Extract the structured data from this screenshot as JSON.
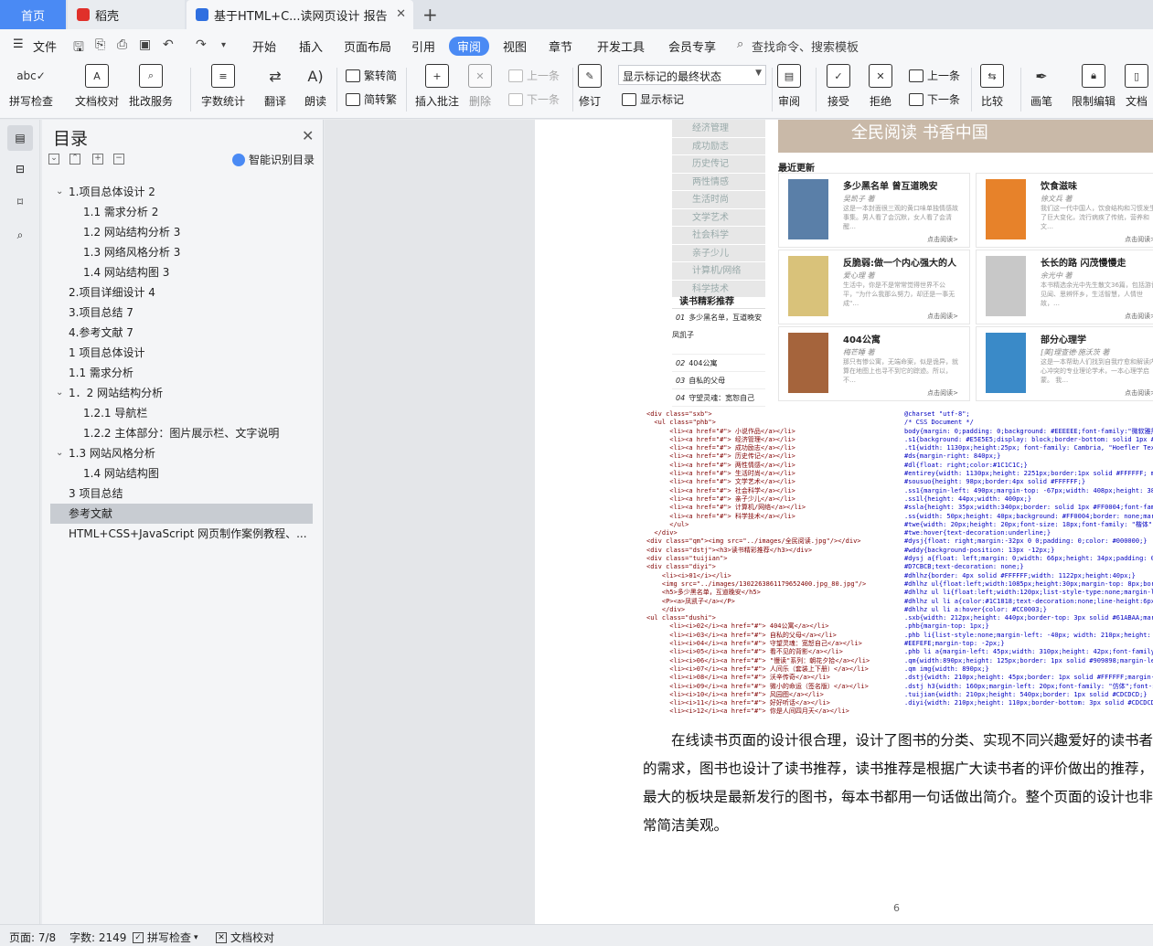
{
  "tabs": {
    "home": "首页",
    "daoke": "稻壳",
    "doc": "基于HTML+C...读网页设计 报告"
  },
  "menu": {
    "file": "文件",
    "items": [
      "开始",
      "插入",
      "页面布局",
      "引用",
      "审阅",
      "视图",
      "章节",
      "开发工具",
      "会员专享"
    ],
    "search": "查找命令、搜索模板"
  },
  "toolbar": {
    "spellcheck": "拼写检查",
    "doc_check": "文档校对",
    "batch": "批改服务",
    "word_count": "字数统计",
    "translate": "翻译",
    "read_aloud": "朗读",
    "to_trad": "繁转简",
    "to_simp": "简转繁",
    "insert_comment": "插入批注",
    "delete": "删除",
    "prev_comment": "上一条",
    "next_comment": "下一条",
    "revise": "修订",
    "markup_mode": "显示标记的最终状态",
    "show_markup": "显示标记",
    "review": "审阅",
    "accept": "接受",
    "reject": "拒绝",
    "prev": "上一条",
    "next": "下一条",
    "compare": "比较",
    "pen": "画笔",
    "restrict": "限制编辑",
    "doc_right": "文档"
  },
  "toc": {
    "title": "目录",
    "smart": "智能识别目录",
    "items": [
      {
        "label": "1.项目总体设计  2",
        "caret": "v"
      },
      {
        "label": "1.1 需求分析  2",
        "caret": ""
      },
      {
        "label": "1.2 网站结构分析  3",
        "caret": ""
      },
      {
        "label": "1.3 网络风格分析  3",
        "caret": ""
      },
      {
        "label": "1.4 网站结构图  3",
        "caret": ""
      },
      {
        "label": "2.项目详细设计  4",
        "caret": ""
      },
      {
        "label": "3.项目总结  7",
        "caret": ""
      },
      {
        "label": "4.参考文献  7",
        "caret": ""
      },
      {
        "label": "1 项目总体设计",
        "caret": ""
      },
      {
        "label": "1.1  需求分析",
        "caret": ""
      },
      {
        "label": "1．2 网站结构分析",
        "caret": "v"
      },
      {
        "label": "1.2.1 导航栏",
        "caret": ""
      },
      {
        "label": "1.2.2 主体部分：图片展示栏、文字说明",
        "caret": ""
      },
      {
        "label": "1.3  网站风格分析",
        "caret": "v"
      },
      {
        "label": "1.4  网站结构图",
        "caret": ""
      },
      {
        "label": "3 项目总结",
        "caret": ""
      },
      {
        "label": "参考文献",
        "caret": ""
      },
      {
        "label": "HTML+CSS+JavaScript 网页制作案例教程、...",
        "caret": ""
      }
    ]
  },
  "shot": {
    "categories": [
      "经济管理",
      "成功励志",
      "历史传记",
      "两性情感",
      "生活时尚",
      "文学艺术",
      "社会科学",
      "亲子少儿",
      "计算机/网络",
      "科学技术"
    ],
    "banner": "全民阅读  书香中国",
    "latest": "最近更新",
    "books": [
      {
        "title": "多少黑名单 曾互道晚安",
        "author": "吴凯子 著",
        "desc": "这是一本封面很三观的黄口味单独情感故事集。男人看了会沉默，女人看了会清醒…",
        "read": "点击阅读>",
        "color": "#5a7fa8"
      },
      {
        "title": "饮食滋味",
        "author": "徐文兵 著",
        "desc": "我们这一代中国人，饮食结构和习惯发生了巨大变化，流行病疾了传统，营养和文…",
        "read": "点击阅读>",
        "color": "#e7822a"
      },
      {
        "title": "反脆弱:做一个内心强大的人",
        "author": "爱心理 著",
        "desc": "生活中，你是不是常常觉得世界不公平，\"为什么我那么努力，却还是一事无成\"…",
        "read": "点击阅读>",
        "color": "#d9c27a"
      },
      {
        "title": "长长的路 闪茂慢慢走",
        "author": "余光中 著",
        "desc": "本书精选余光中先生散文36篇，包括游记见闻、思辨怀乡，生活智慧，人情世故，…",
        "read": "点击阅读>",
        "color": "#c8c8c8"
      },
      {
        "title": "404公寓",
        "author": "梅芒睡 著",
        "desc": "那只有惨公寓，无端命案，似是诡异，就算在地图上也寻不到它的踪迹。所以，不…",
        "read": "点击阅读>",
        "color": "#a5643c"
      },
      {
        "title": "部分心理学",
        "author": "[美]理查德·施沃茨 著",
        "desc": "这是一本帮助人们找到自我疗愈和解读内心冲突的专业理论学术，一本心理学启蒙。 我…",
        "read": "点击阅读>",
        "color": "#3a8ac8"
      }
    ],
    "rec_title": "读书精彩推荐",
    "rec": [
      {
        "num": "01",
        "text": "多少黑名单，互道晚安  凤凯子"
      },
      {
        "num": "02",
        "text": "404公寓"
      },
      {
        "num": "03",
        "text": "自私的父母"
      },
      {
        "num": "04",
        "text": "守望灵魂：宽恕自己"
      }
    ]
  },
  "code_left": [
    "<div class=\"sxb\">",
    "  <ul class=\"phb\">",
    "      <li><a href=\"#\"> 小说作品</a></li>",
    "      <li><a href=\"#\"> 经济管理</a></li>",
    "      <li><a href=\"#\"> 成功励志</a></li>",
    "      <li><a href=\"#\"> 历史传记</a></li>",
    "      <li><a href=\"#\"> 两性情感</a></li>",
    "      <li><a href=\"#\"> 生活时尚</a></li>",
    "      <li><a href=\"#\"> 文学艺术</a></li>",
    "      <li><a href=\"#\"> 社会科学</a></li>",
    "      <li><a href=\"#\"> 亲子少儿</a></li>",
    "      <li><a href=\"#\"> 计算机/网络</a></li>",
    "      <li><a href=\"#\"> 科学技术</a></li>",
    "      </ul>",
    "  </div>",
    "<div class=\"qm\"><img src=\"../images/全民阅读.jpg\"/></div>",
    "<div class=\"dstj\"><h3>读书精彩推荐</h3></div>",
    "<div class=\"tuijian\">",
    "<div class=\"diyi\">",
    "    <li><i>01</i></li>",
    "    <img src=\"../images/1302263861179652400.jpg_80.jpg\"/>",
    "    <h5>多少黑名单，互道晚安</h5>",
    "    <P><a>凤凯子</a></P>",
    "    </div>",
    "<ul class=\"dushi\">",
    "      <li><i>02</i><a href=\"#\"> 404公寓</a></li>",
    "      <li><i>03</i><a href=\"#\"> 自私的父母</a></li>",
    "      <li><i>04</i><a href=\"#\"> 守望灵魂：宽恕自己</a></li>",
    "      <li><i>05</i><a href=\"#\"> 看不见的背影</a></li>",
    "      <li><i>06</i><a href=\"#\"> \"慢读\"系列：朝花夕拾</a></li>",
    "      <li><i>07</i><a href=\"#\"> 人间乐（套装上下册）</a></li>",
    "      <li><i>08</i><a href=\"#\"> 沃辛传奇</a></li>",
    "      <li><i>09</i><a href=\"#\"> 微小的命运（签名版）</a></li>",
    "      <li><i>10</i><a href=\"#\"> 风园图</a></li>",
    "      <li><i>11</i><a href=\"#\"> 好好听话</a></li>",
    "      <li><i>12</i><a href=\"#\"> 你是人间四月天</a></li>"
  ],
  "code_right": [
    "@charset \"utf-8\";",
    "/* CSS Document */",
    "body{margin: 0;padding: 0;background: #EEEEEE;font-family:\"微软雅黑\"",
    ".s1{background: #E5E5E5;display: block;border-bottom: solid 1px #DD",
    ".t1{width: 1130px;height:25px; font-family: Cambria, \"Hoefler Text\"",
    "#ds{margin-right: 840px;}",
    "#dl{float: right;color:#1C1C1C;}",
    "#entirey{width: 1130px;height: 2251px;border:1px solid #FFFFFF; mar",
    "#sousuo{height: 98px;border:4px solid #FFFFFF;}",
    ".ss1{margin-left: 490px;margin-top: -67px;width: 408px;height: 38px",
    ".ss1l{height: 44px;width: 400px;}",
    "#ssla{height: 35px;width:340px;border: solid 1px #FF0004;font-fami",
    ".ss{width: 50px;height: 40px;background: #FF0004;border: none;margi",
    "#twe{width: 20px;height: 20px;font-size: 18px;font-family: \"楷体\";",
    "#twe:hover{text-decoration:underline;}",
    "#dysj{float: right;margin:-32px 0 0;padding: 0;color: #000000;}",
    "#wddy{background-position: 13px -12px;}",
    "#dysj a{float: left;margin: 0;width: 66px;height: 34px;padding: 0 0",
    "#D7CBCB;text-decoration: none;}",
    "#dhlhz{border: 4px solid #FFFFFF;width: 1122px;height:40px;}",
    "#dhlhz ul{float:left;width:1085px;height:30px;margin-top: 8px;borde",
    "#dhlhz ul li{float:left;width:120px;list-style-type:none;margin-lef",
    "#dhlhz ul li a{color:#1C1818;text-decoration:none;line-height:6px;}",
    "#dhlhz ul li a:hover{color: #CC0003;}",
    ".sxb{width: 212px;height: 440px;border-top: 3px solid #61ABAA;margi",
    ".phb{margin-top: 1px;}",
    ".phb li{list-style:none;margin-left: -40px; width: 210px;height: 40",
    "#EEFEFE;margin-top: -2px;}",
    ".phb li a{margin-left: 45px;width: 310px;height: 42px;font-family:",
    ".qm{width:890px;height: 125px;border: 1px solid #909898;margin-left",
    ".qm img{width: 890px;}",
    ".dstj{width: 210px;height: 45px;border: 1px solid #FFFFFF;margin-to",
    ".dstj h3{width: 160px;margin-left: 20px;font-family: \"仿体\";font-si",
    ".tuijian{width: 210px;height: 540px;border: 1px solid #CDCDCD;}",
    ".diyi{width: 210px;height: 110px;border-bottom: 3px solid #CDCDCD;}"
  ],
  "paragraph": "在线读书页面的设计很合理，设计了图书的分类、实现不同兴趣爱好的读书者的需求，图书也设计了读书推荐，读书推荐是根据广大读书者的评价做出的推荐，最大的板块是最新发行的图书，每本书都用一句话做出简介。整个页面的设计也非常简洁美观。",
  "page_number": "6",
  "status": {
    "page": "页面: 7/8",
    "words": "字数: 2149",
    "spell": "拼写检查",
    "proof": "文档校对"
  },
  "colors": {
    "accent": "#4a8af4",
    "toc_selected": "#c8ccd2"
  }
}
